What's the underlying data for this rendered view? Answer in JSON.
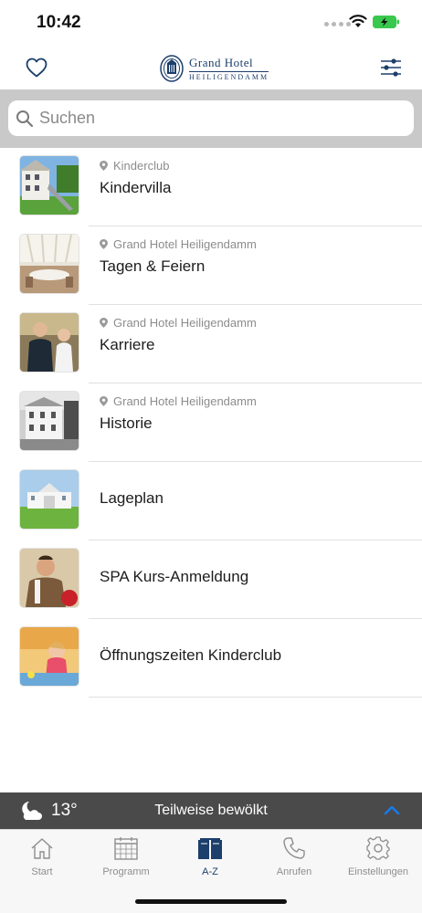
{
  "status_bar": {
    "time": "10:42"
  },
  "header": {
    "logo_line1": "Grand Hotel",
    "logo_line2": "HEILIGENDAMM"
  },
  "search": {
    "placeholder": "Suchen"
  },
  "list": [
    {
      "location": "Kinderclub",
      "title": "Kindervilla"
    },
    {
      "location": "Grand Hotel Heiligendamm",
      "title": "Tagen & Feiern"
    },
    {
      "location": "Grand Hotel Heiligendamm",
      "title": "Karriere"
    },
    {
      "location": "Grand Hotel Heiligendamm",
      "title": "Historie"
    },
    {
      "location": "",
      "title": "Lageplan"
    },
    {
      "location": "",
      "title": "SPA Kurs-Anmeldung"
    },
    {
      "location": "",
      "title": "Öffnungszeiten Kinderclub"
    }
  ],
  "weather": {
    "temp": "13°",
    "description": "Teilweise bewölkt",
    "icon": "moon-cloud-icon"
  },
  "tabs": [
    {
      "label": "Start",
      "icon": "home-icon",
      "active": false
    },
    {
      "label": "Programm",
      "icon": "calendar-icon",
      "active": false
    },
    {
      "label": "A-Z",
      "icon": "book-icon",
      "active": true
    },
    {
      "label": "Anrufen",
      "icon": "phone-icon",
      "active": false
    },
    {
      "label": "Einstellungen",
      "icon": "gear-icon",
      "active": false
    }
  ],
  "colors": {
    "brand": "#1c3f6b",
    "accent": "#1a7ae8",
    "search_bg": "#c9c9c9",
    "weather_bg": "#4a4a4a",
    "battery": "#39c84d"
  }
}
